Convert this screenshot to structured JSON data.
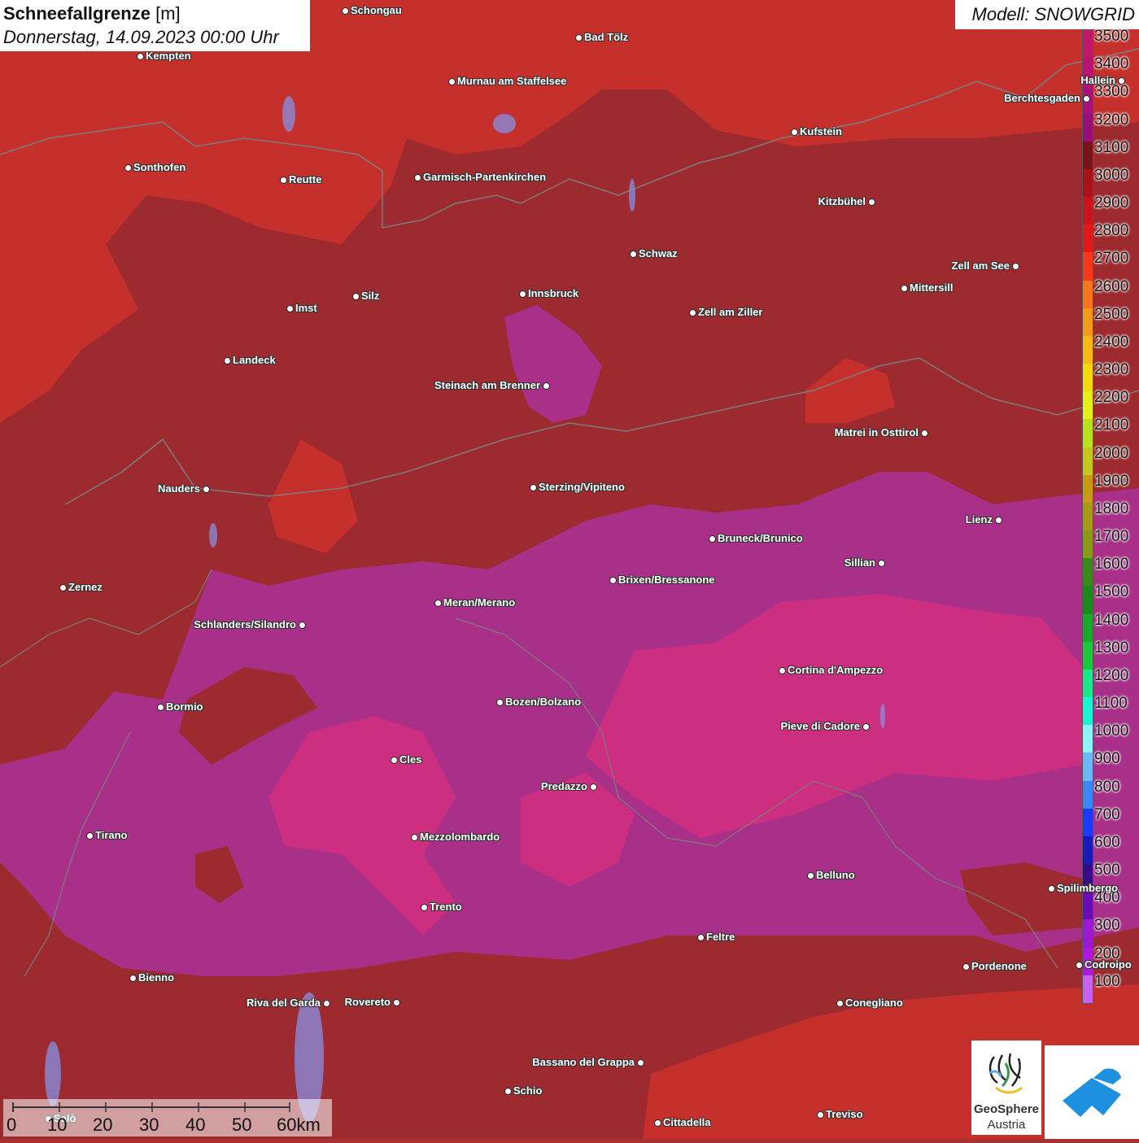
{
  "title": {
    "variable": "Schneefallgrenze",
    "unit": "[m]",
    "datetime": "Donnerstag, 14.09.2023 00:00 Uhr"
  },
  "model_label": "Modell: SNOWGRID",
  "legend": {
    "labels": [
      "3500",
      "3400",
      "3300",
      "3200",
      "3100",
      "3000",
      "2900",
      "2800",
      "2700",
      "2600",
      "2500",
      "2400",
      "2300",
      "2200",
      "2100",
      "2000",
      "1900",
      "1800",
      "1700",
      "1600",
      "1500",
      "1400",
      "1300",
      "1200",
      "1100",
      "1000",
      "900",
      "800",
      "700",
      "600",
      "500",
      "400",
      "300",
      "200",
      "100"
    ],
    "colors": [
      "#c2186b",
      "#b81470",
      "#a81277",
      "#96107a",
      "#7a1218",
      "#a8121a",
      "#c8141c",
      "#e01a1a",
      "#f53a1c",
      "#f5781c",
      "#f59a18",
      "#f5b814",
      "#f5d810",
      "#e6f018",
      "#b8e01c",
      "#c8c81c",
      "#c89a14",
      "#a89a14",
      "#8a9a14",
      "#3a8a1a",
      "#1a8a1a",
      "#1aa82a",
      "#1ac83a",
      "#1ae888",
      "#1af5d0",
      "#8af5f5",
      "#6ab8f5",
      "#3a88f5",
      "#1a3af5",
      "#1a1ab8",
      "#3a0a88",
      "#6a0ab8",
      "#9a1ad8",
      "#b01ae0",
      "#c860f0"
    ]
  },
  "cities": [
    {
      "name": "Schongau"
    },
    {
      "name": "Bad Tölz"
    },
    {
      "name": "Kempten"
    },
    {
      "name": "Murnau am Staffelsee"
    },
    {
      "name": "Hallein"
    },
    {
      "name": "Berchtesgaden"
    },
    {
      "name": "Kufstein"
    },
    {
      "name": "Sonthofen"
    },
    {
      "name": "Reutte"
    },
    {
      "name": "Garmisch-Partenkirchen"
    },
    {
      "name": "Kitzbühel"
    },
    {
      "name": "Schwaz"
    },
    {
      "name": "Zell am See"
    },
    {
      "name": "Mittersill"
    },
    {
      "name": "Innsbruck"
    },
    {
      "name": "Imst"
    },
    {
      "name": "Silz"
    },
    {
      "name": "Zell am Ziller"
    },
    {
      "name": "Landeck"
    },
    {
      "name": "Steinach am Brenner"
    },
    {
      "name": "Matrei in Osttirol"
    },
    {
      "name": "Nauders"
    },
    {
      "name": "Sterzing/Vipiteno"
    },
    {
      "name": "Lienz"
    },
    {
      "name": "Bruneck/Brunico"
    },
    {
      "name": "Sillian"
    },
    {
      "name": "Zernez"
    },
    {
      "name": "Brixen/Bressanone"
    },
    {
      "name": "Meran/Merano"
    },
    {
      "name": "Schlanders/Silandro"
    },
    {
      "name": "Cortina d'Ampezzo"
    },
    {
      "name": "Bormio"
    },
    {
      "name": "Bozen/Bolzano"
    },
    {
      "name": "Pieve di Cadore"
    },
    {
      "name": "Cles"
    },
    {
      "name": "Predazzo"
    },
    {
      "name": "Tirano"
    },
    {
      "name": "Mezzolombardo"
    },
    {
      "name": "Belluno"
    },
    {
      "name": "Spilimbergo"
    },
    {
      "name": "Trento"
    },
    {
      "name": "Feltre"
    },
    {
      "name": "Pordenone"
    },
    {
      "name": "Codroipo"
    },
    {
      "name": "Bienno"
    },
    {
      "name": "Riva del Garda"
    },
    {
      "name": "Rovereto"
    },
    {
      "name": "Conegliano"
    },
    {
      "name": "Bassano del Grappa"
    },
    {
      "name": "Schio"
    },
    {
      "name": "Treviso"
    },
    {
      "name": "Cittadella"
    },
    {
      "name": "Salò"
    }
  ],
  "scale_bar": {
    "labels": [
      "0",
      "10",
      "20",
      "30",
      "40",
      "50",
      "60km"
    ]
  },
  "logos": {
    "geosphere_line1": "GeoSphere",
    "geosphere_line2": "Austria"
  },
  "colors": {
    "outer_red": "#c6302c",
    "valley_dark_red": "#9c2a2e",
    "magenta": "#a83088",
    "pink": "#cc2f80",
    "lake": "#8a8ad8"
  }
}
